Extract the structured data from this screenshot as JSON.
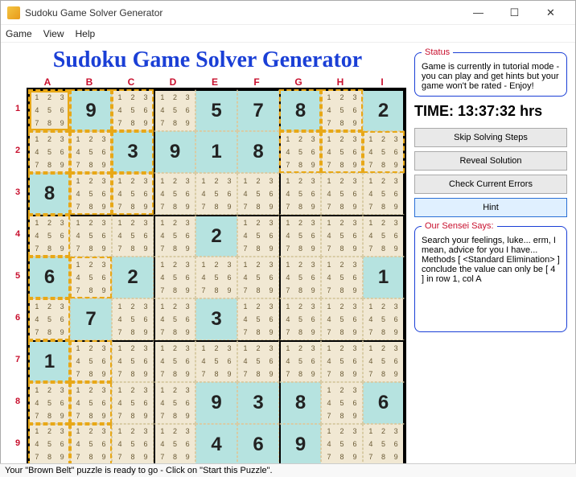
{
  "window": {
    "title": "Sudoku Game Solver Generator"
  },
  "menu": {
    "items": [
      "Game",
      "View",
      "Help"
    ]
  },
  "heading": "Sudoku Game Solver Generator",
  "columns": [
    "A",
    "B",
    "C",
    "D",
    "E",
    "F",
    "G",
    "H",
    "I"
  ],
  "rows": [
    "1",
    "2",
    "3",
    "4",
    "5",
    "6",
    "7",
    "8",
    "9"
  ],
  "pencil_all": [
    "1",
    "2",
    "3",
    "4",
    "5",
    "6",
    "7",
    "8",
    "9"
  ],
  "givens": {
    "0,1": "9",
    "0,4": "5",
    "0,5": "7",
    "0,6": "8",
    "0,8": "2",
    "1,2": "3",
    "1,3": "9",
    "1,4": "1",
    "1,5": "8",
    "2,0": "8",
    "3,4": "2",
    "4,0": "6",
    "4,2": "2",
    "4,8": "1",
    "5,1": "7",
    "5,4": "3",
    "6,0": "1",
    "7,4": "9",
    "7,5": "3",
    "7,6": "8",
    "7,8": "6",
    "8,4": "4",
    "8,5": "6",
    "8,6": "9"
  },
  "highlight_region": [
    "0,0",
    "0,1",
    "0,2",
    "0,6",
    "0,7",
    "1,0",
    "1,1",
    "1,2",
    "1,6",
    "1,7",
    "1,8",
    "2,0",
    "2,1",
    "2,2",
    "3,0",
    "4,0",
    "5,0",
    "6,0",
    "7,0",
    "8,0",
    "4,1",
    "6,1",
    "7,1",
    "8,1"
  ],
  "hint_cell": "0,0",
  "status": {
    "legend": "Status",
    "text": "Game is currently in tutorial mode - you can play and get hints but your game won't be rated - Enjoy!"
  },
  "time": {
    "label": "TIME:",
    "value": "13:37:32",
    "unit": "hrs"
  },
  "buttons": {
    "skip": "Skip Solving Steps",
    "reveal": "Reveal Solution",
    "check": "Check Current Errors",
    "hint": "Hint"
  },
  "sensei": {
    "legend": "Our Sensei Says:",
    "text": "Search your feelings, luke... erm, I mean, advice for you I have...\nMethods [ <Standard Elimination> ] conclude the value can only be [ 4 ] in row 1, col A"
  },
  "statusbar": "Your \"Brown Belt\" puzzle is ready to go - Click on \"Start this Puzzle\"."
}
